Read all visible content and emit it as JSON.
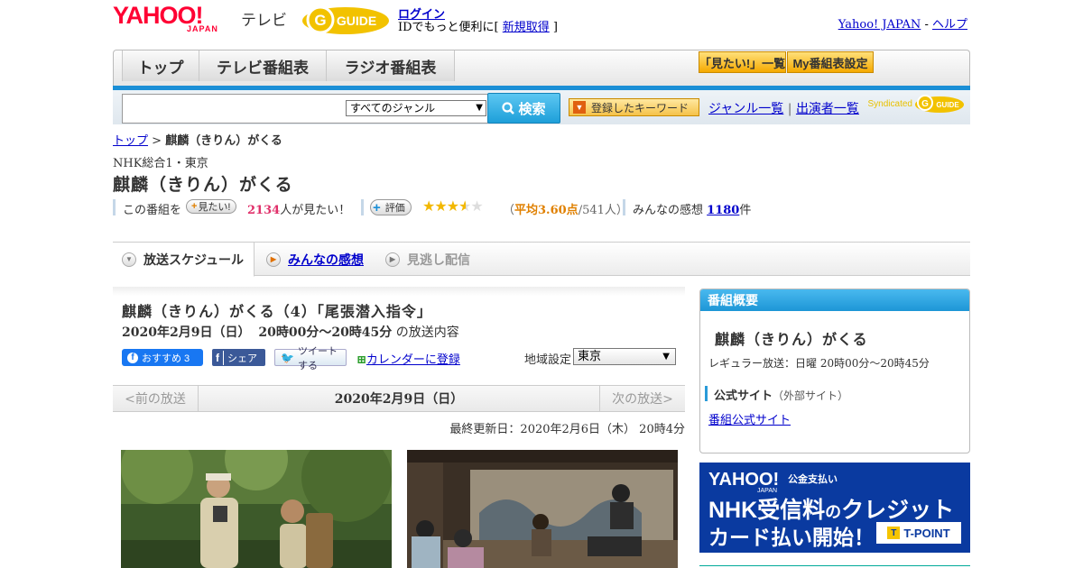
{
  "header": {
    "yahoo_logo": "YAHOO!",
    "yahoo_japan": "JAPAN",
    "tv_label": "テレビ",
    "gguide_logo": "G GUIDE",
    "login_link": "ログイン",
    "login_msg_prefix": "IDでもっと便利に[ ",
    "register_link": "新規取得",
    "login_msg_suffix": " ]",
    "yahoo_japan_link": "Yahoo! JAPAN",
    "separator": " - ",
    "help_link": "ヘルプ"
  },
  "nav": {
    "tabs": [
      {
        "label": "トップ"
      },
      {
        "label": "テレビ番組表"
      },
      {
        "label": "ラジオ番組表"
      }
    ],
    "mitai_list": "「見たい!」一覧",
    "my_program": "My番組表設定"
  },
  "search": {
    "input_value": "",
    "genre_selected": "すべてのジャンル",
    "search_button": "検索",
    "keyword_button": "登録したキーワード",
    "genre_list_link": "ジャンル一覧",
    "divider": "|",
    "performer_link": "出演者一覧",
    "syndicated": "Syndicated",
    "syndicated_logo": "GUIDE"
  },
  "breadcrumb": {
    "top": "トップ",
    "sep": " > ",
    "current": "麒麟（きりん）がくる"
  },
  "program": {
    "channel": "NHK総合1・東京",
    "title": "麒麟（きりん）がくる",
    "mitai_prefix": "この番組を",
    "mitai_button": "見たい!",
    "mitai_count": "2134",
    "mitai_suffix": "人が見たい！",
    "rate_button": "評価",
    "rating_stars": 3.6,
    "avg_open": "（",
    "avg_text": "平均3.60点",
    "avg_count": "/541人）",
    "impressions_label": "みんなの感想",
    "impressions_count": "1180",
    "impressions_suffix": "件"
  },
  "tabs": [
    {
      "label": "放送スケジュール",
      "active": true
    },
    {
      "label": "みんなの感想",
      "active": false
    },
    {
      "label": "見逃し配信",
      "active": false
    }
  ],
  "episode": {
    "title": "麒麟（きりん）がくる（4）「尾張潜入指令」",
    "date": "2020年2月9日（日）",
    "time": "20時00分～20時45分",
    "date_suffix": "の放送内容",
    "fb_recommend": "おすすめ 3",
    "fb_share": "シェア",
    "tweet": "ツイートする",
    "calendar_link": "カレンダーに登録",
    "region_label": "地域設定",
    "region_selected": "東京"
  },
  "datenav": {
    "prev": "<前の放送",
    "current": "2020年2月9日（日）",
    "next": "次の放送>"
  },
  "updated": "最終更新日：2020年2月6日（木） 20時4分",
  "overview": {
    "heading": "番組概要",
    "title": "麒麟（きりん）がくる",
    "regular": "レギュラー放送：日曜 20時00分～20時45分",
    "official_label": "公式サイト",
    "official_note": "（外部サイト）",
    "official_link": "番組公式サイト"
  },
  "banner": {
    "logo": "YAHOO!",
    "japan": "JAPAN",
    "service": "公金支払い",
    "line1_a": "NHK受信料",
    "line1_b": "の",
    "line1_c": "クレジット",
    "line2": "カード払い開始！",
    "tpoint": "T-POINT"
  },
  "colors": {
    "accent_blue": "#1b8fd6",
    "link": "#0000cc",
    "orange": "#e08000",
    "pink_count": "#e0306a",
    "banner_bg": "#0a3aa0"
  }
}
